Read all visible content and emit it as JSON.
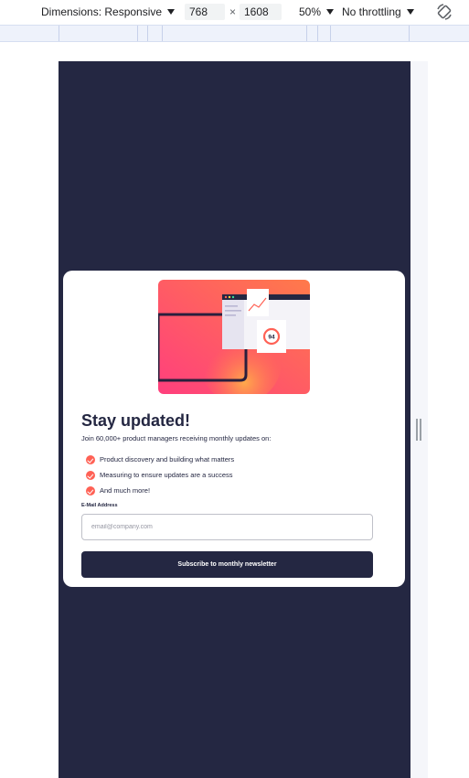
{
  "devtools": {
    "dimensions_label": "Dimensions: Responsive",
    "width": "768",
    "times": "×",
    "height": "1608",
    "zoom": "50%",
    "throttling": "No throttling"
  },
  "card": {
    "illustration_score": "94",
    "title": "Stay updated!",
    "intro": "Join 60,000+ product managers receiving monthly updates on:",
    "bullets": [
      "Product discovery and building what matters",
      "Measuring to ensure updates are a success",
      "And much more!"
    ],
    "email_label": "E-Mail Address",
    "email_placeholder": "email@company.com",
    "email_value": "",
    "submit_label": "Subscribe to monthly newsletter"
  },
  "colors": {
    "dark_navy": "#242742",
    "tomato": "#ff6155",
    "white": "#ffffff"
  }
}
